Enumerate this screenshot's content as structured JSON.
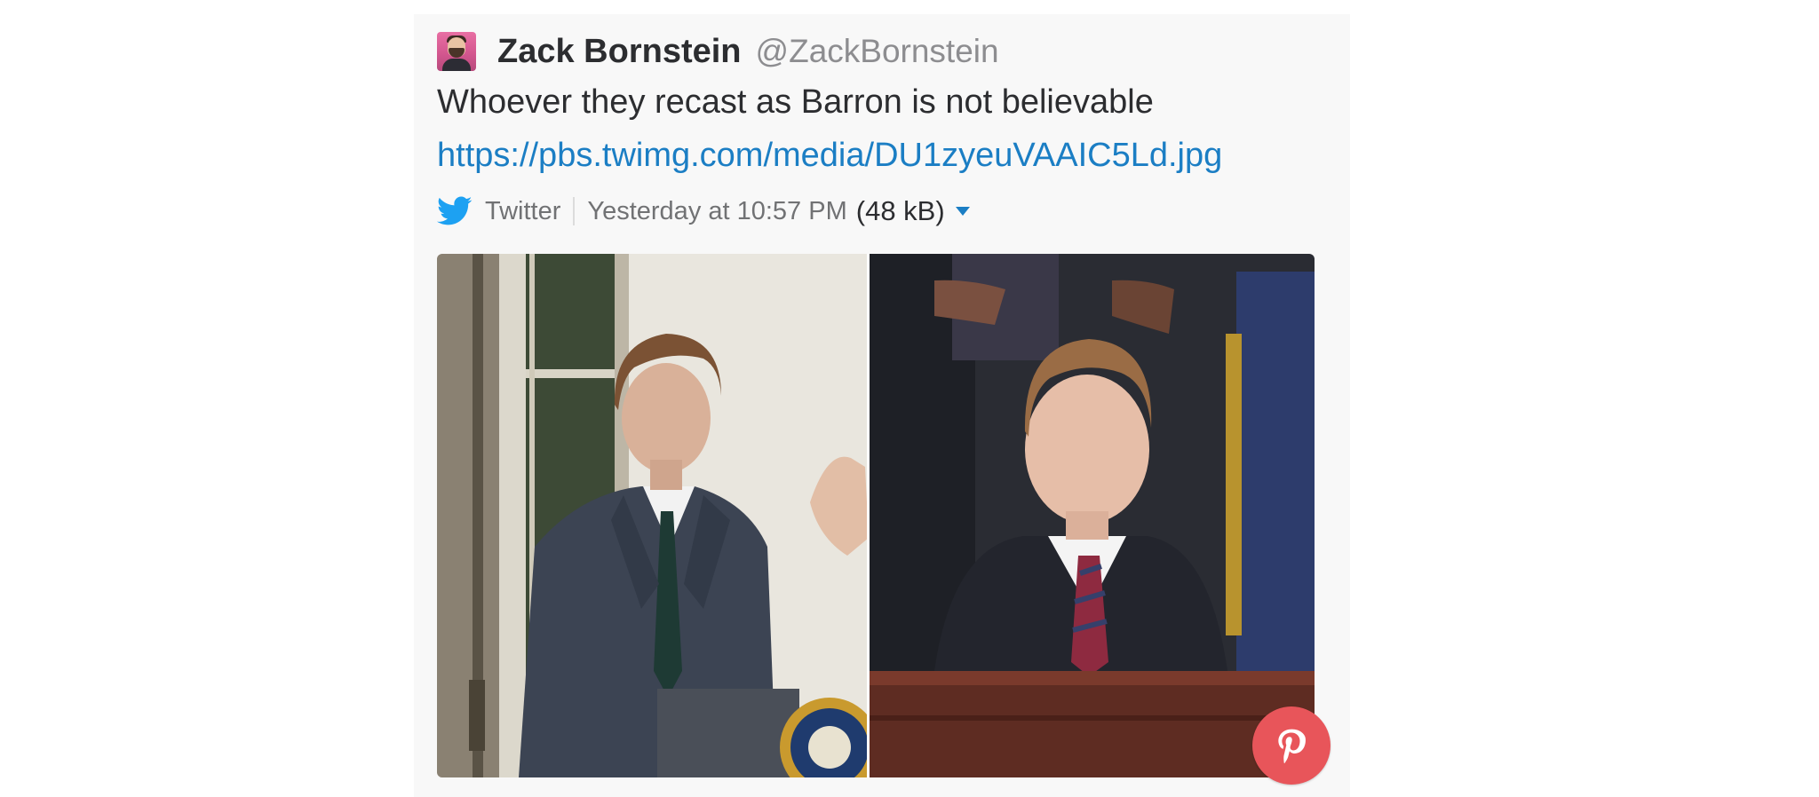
{
  "tweet": {
    "author_name": "Zack Bornstein",
    "author_handle": "@ZackBornstein",
    "text": "Whoever they recast as Barron is not believable",
    "link": "https://pbs.twimg.com/media/DU1zyeuVAAIC5Ld.jpg",
    "source": "Twitter",
    "timestamp": "Yesterday at 10:57 PM",
    "file_size": "(48 kB)"
  },
  "icons": {
    "source_icon": "twitter-bird-icon",
    "caret_icon": "caret-down-icon",
    "pin_icon": "pinterest-icon"
  },
  "colors": {
    "link": "#1b7ec4",
    "twitter_blue": "#1da1f2",
    "pinterest_red": "#e8555a",
    "card_bg": "#f8f8f8"
  }
}
